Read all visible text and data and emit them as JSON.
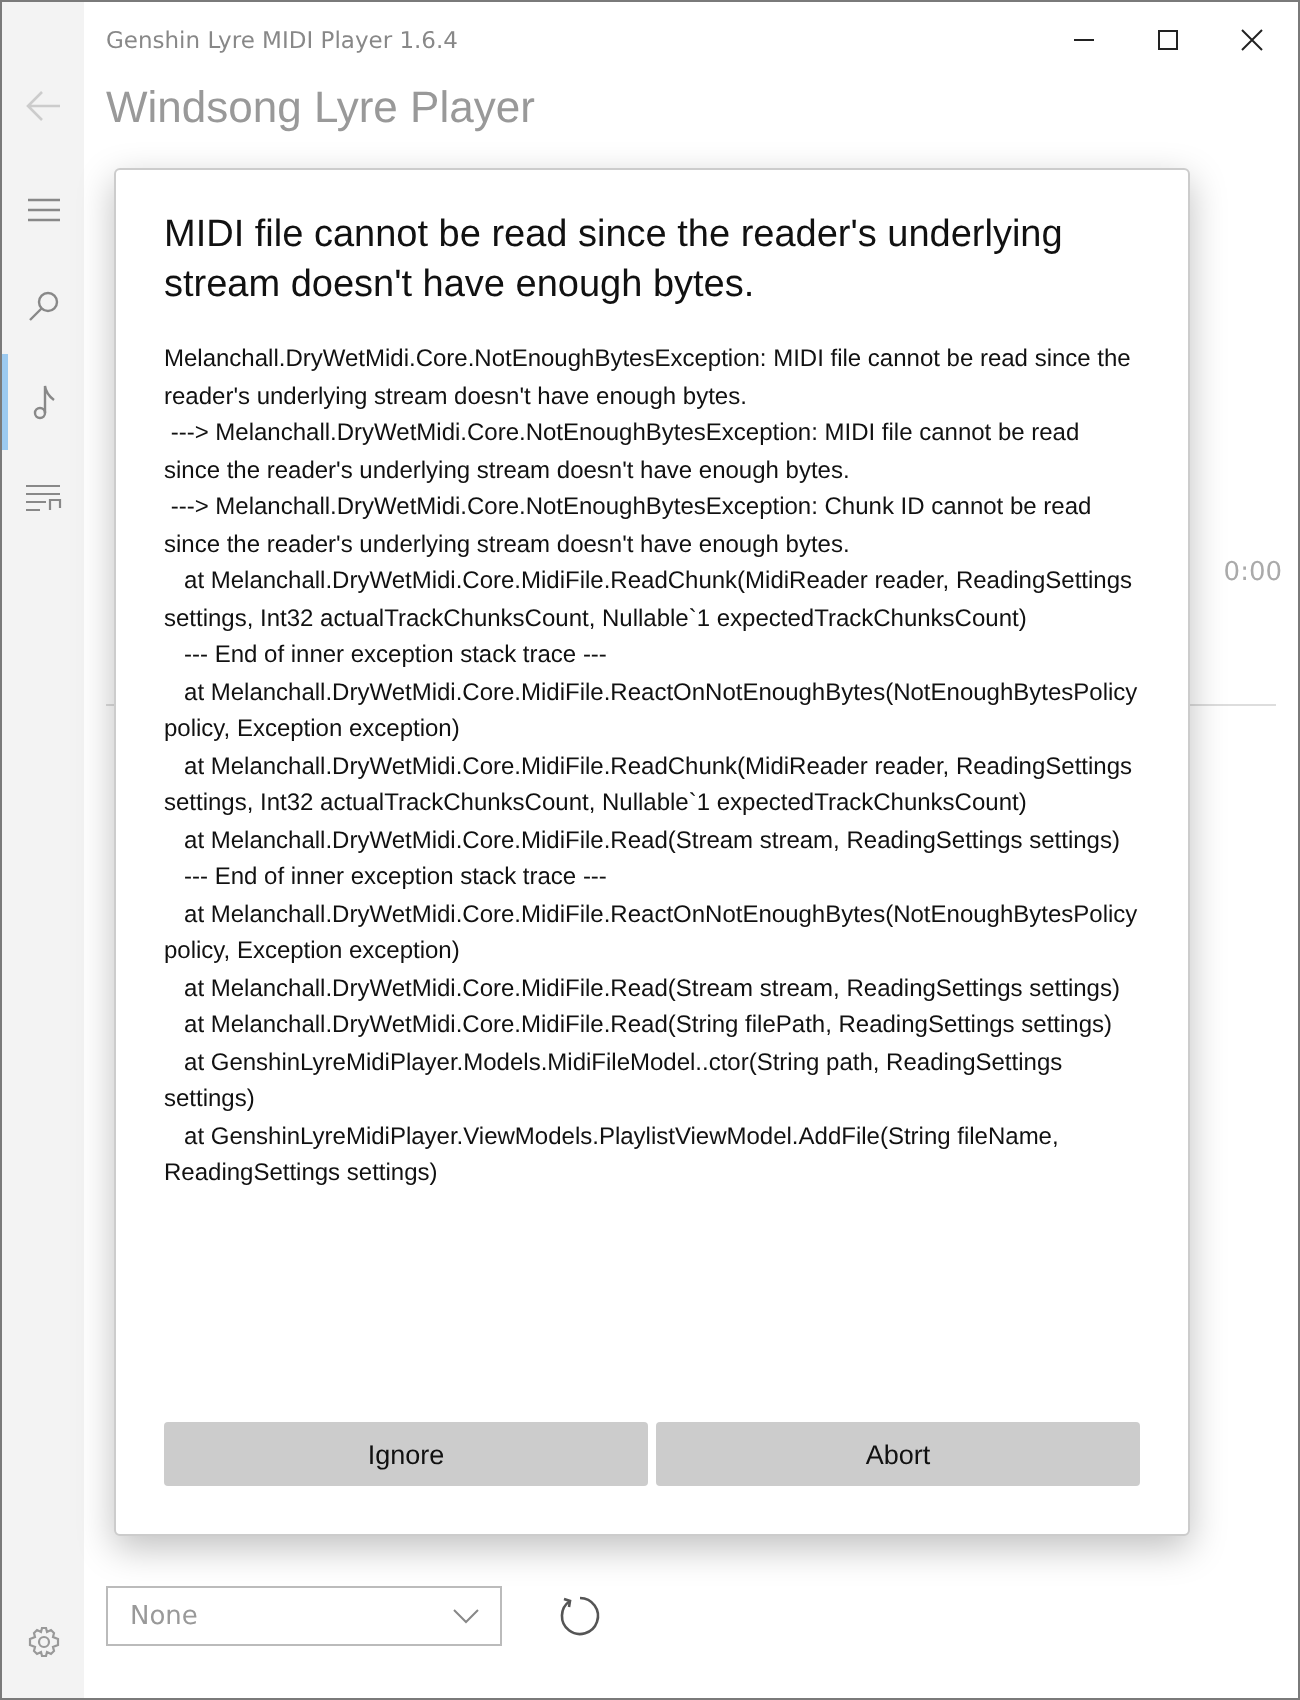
{
  "window": {
    "title": "Genshin Lyre MIDI Player 1.6.4"
  },
  "sidebar": {
    "back_disabled": true,
    "items": [
      {
        "kind": "menu",
        "selected": false
      },
      {
        "kind": "search",
        "selected": false
      },
      {
        "kind": "note",
        "selected": true
      },
      {
        "kind": "playlist",
        "selected": false
      }
    ]
  },
  "page": {
    "title": "Windsong Lyre Player",
    "time": "0:00",
    "dropdown": {
      "value": "None"
    }
  },
  "dialog": {
    "title": "MIDI file cannot be read since the reader's underlying stream doesn't have enough bytes.",
    "details": "Melanchall.DryWetMidi.Core.NotEnoughBytesException: MIDI file cannot be read since the reader's underlying stream doesn't have enough bytes.\n ---> Melanchall.DryWetMidi.Core.NotEnoughBytesException: MIDI file cannot be read since the reader's underlying stream doesn't have enough bytes.\n ---> Melanchall.DryWetMidi.Core.NotEnoughBytesException: Chunk ID cannot be read since the reader's underlying stream doesn't have enough bytes.\n   at Melanchall.DryWetMidi.Core.MidiFile.ReadChunk(MidiReader reader, ReadingSettings settings, Int32 actualTrackChunksCount, Nullable`1 expectedTrackChunksCount)\n   --- End of inner exception stack trace ---\n   at Melanchall.DryWetMidi.Core.MidiFile.ReactOnNotEnoughBytes(NotEnoughBytesPolicy policy, Exception exception)\n   at Melanchall.DryWetMidi.Core.MidiFile.ReadChunk(MidiReader reader, ReadingSettings settings, Int32 actualTrackChunksCount, Nullable`1 expectedTrackChunksCount)\n   at Melanchall.DryWetMidi.Core.MidiFile.Read(Stream stream, ReadingSettings settings)\n   --- End of inner exception stack trace ---\n   at Melanchall.DryWetMidi.Core.MidiFile.ReactOnNotEnoughBytes(NotEnoughBytesPolicy policy, Exception exception)\n   at Melanchall.DryWetMidi.Core.MidiFile.Read(Stream stream, ReadingSettings settings)\n   at Melanchall.DryWetMidi.Core.MidiFile.Read(String filePath, ReadingSettings settings)\n   at GenshinLyreMidiPlayer.Models.MidiFileModel..ctor(String path, ReadingSettings settings)\n   at GenshinLyreMidiPlayer.ViewModels.PlaylistViewModel.AddFile(String fileName, ReadingSettings settings)",
    "buttons": [
      "Ignore",
      "Abort"
    ]
  }
}
